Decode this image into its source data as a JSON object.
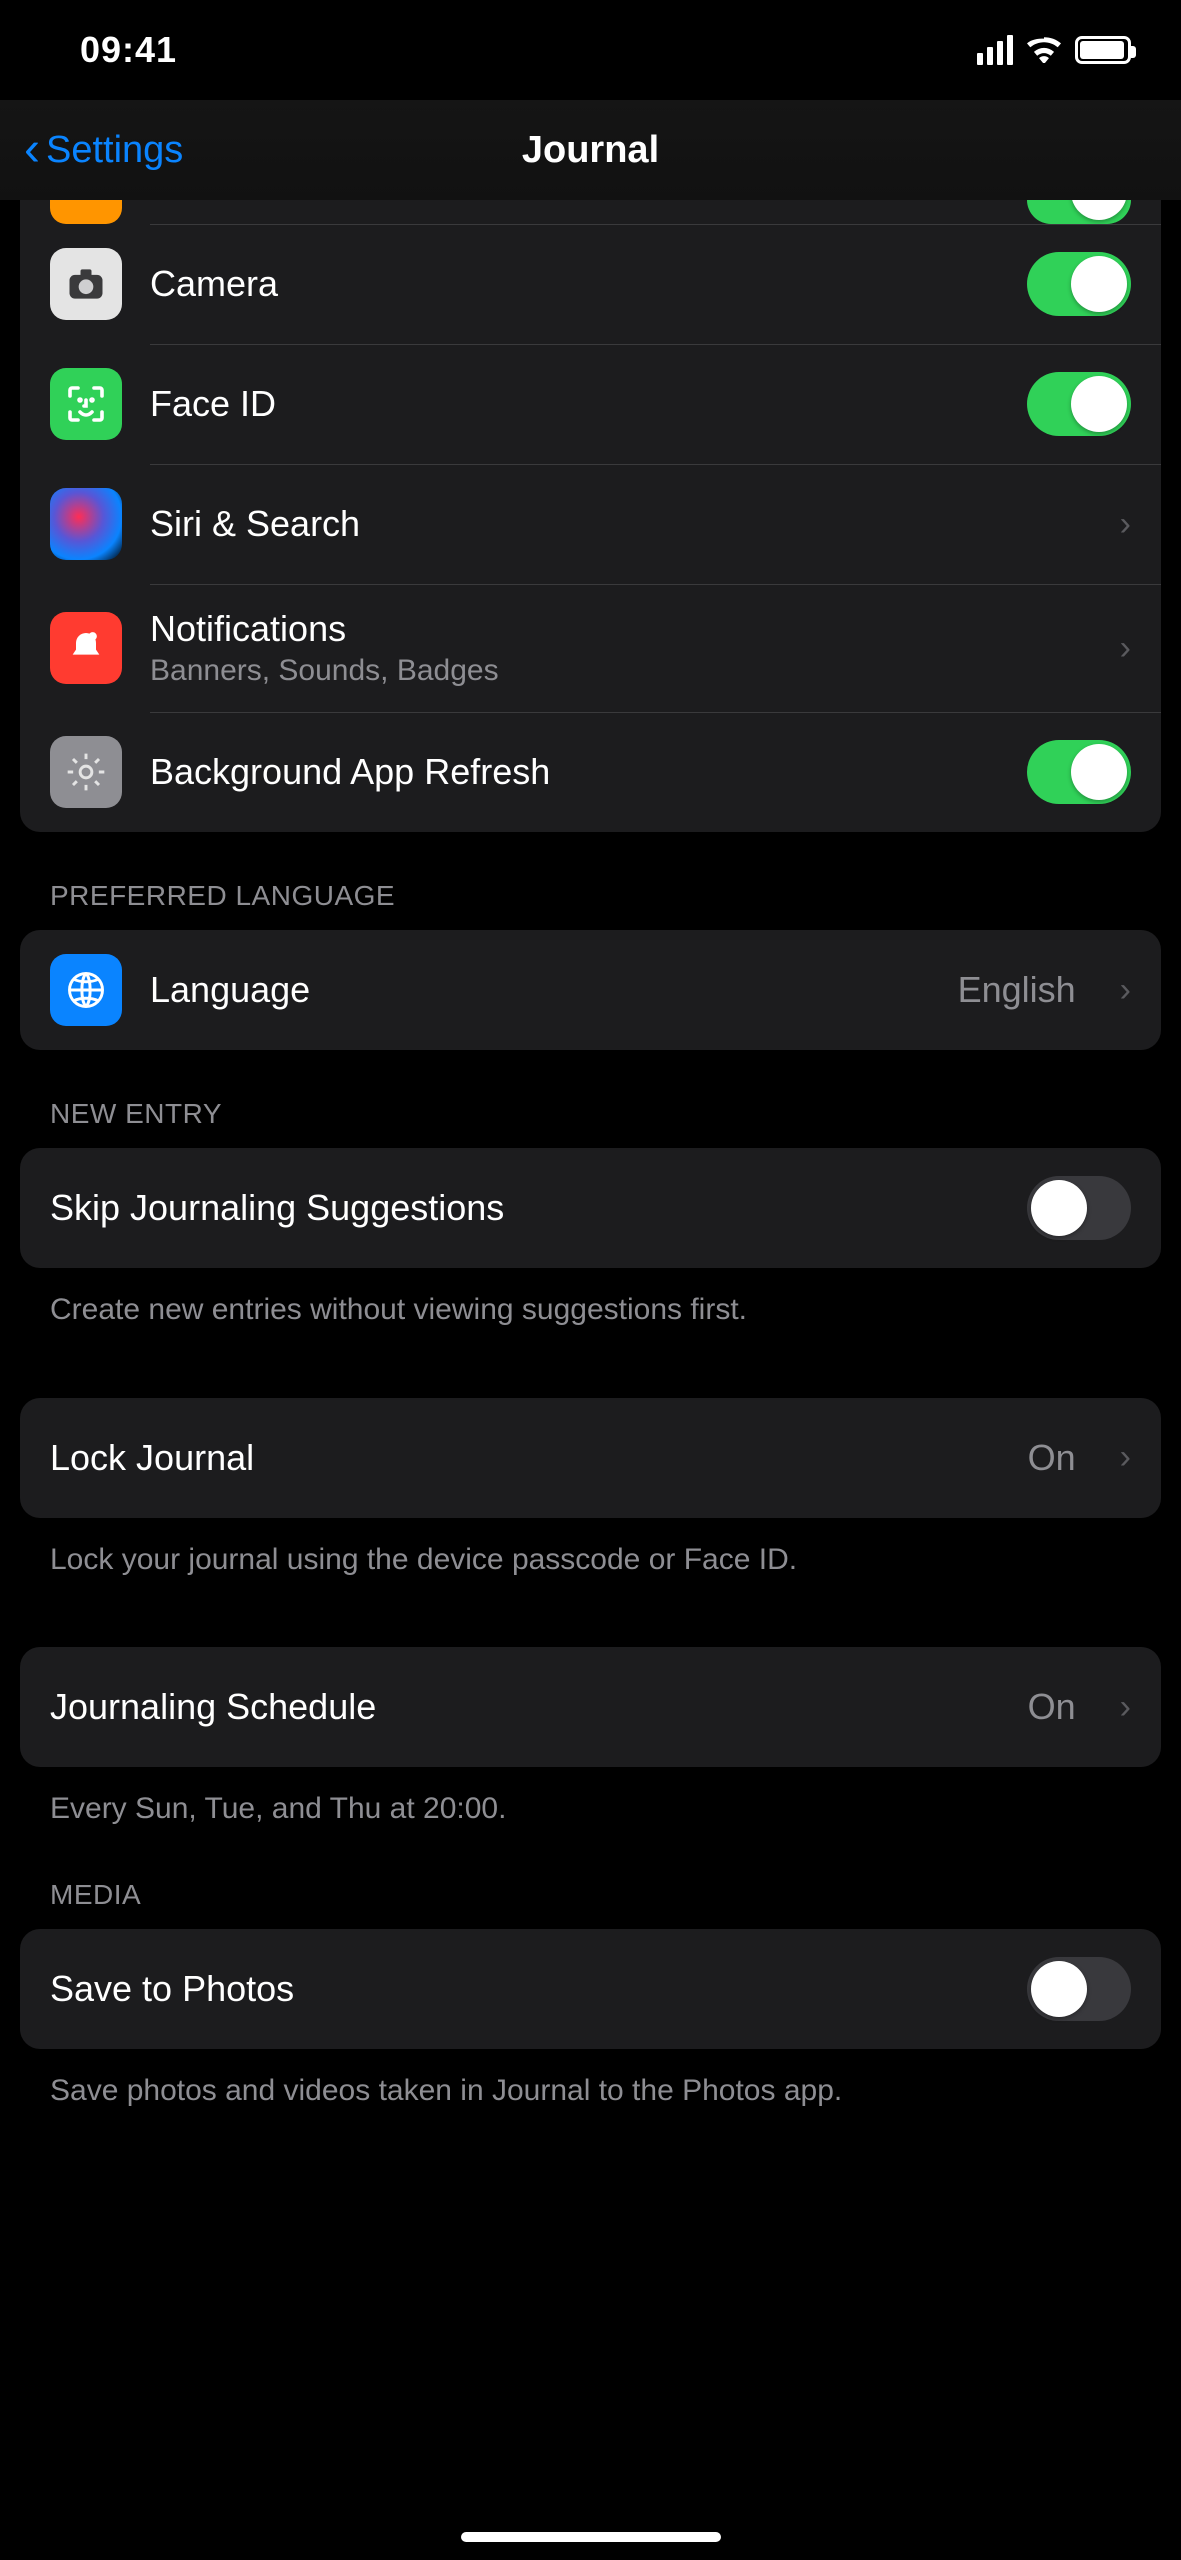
{
  "status": {
    "time": "09:41"
  },
  "nav": {
    "back_label": "Settings",
    "title": "Journal"
  },
  "group1": {
    "rows": [
      {
        "label": "Camera",
        "toggle": true
      },
      {
        "label": "Face ID",
        "toggle": true
      },
      {
        "label": "Siri & Search",
        "nav": true
      },
      {
        "label": "Notifications",
        "sub": "Banners, Sounds, Badges",
        "nav": true
      },
      {
        "label": "Background App Refresh",
        "toggle": true
      }
    ]
  },
  "language": {
    "header": "PREFERRED LANGUAGE",
    "label": "Language",
    "value": "English"
  },
  "new_entry": {
    "header": "NEW ENTRY",
    "skip_label": "Skip Journaling Suggestions",
    "skip_on": false,
    "skip_footer": "Create new entries without viewing suggestions first.",
    "lock_label": "Lock Journal",
    "lock_value": "On",
    "lock_footer": "Lock your journal using the device passcode or Face ID.",
    "schedule_label": "Journaling Schedule",
    "schedule_value": "On",
    "schedule_footer": "Every Sun, Tue, and Thu at 20:00."
  },
  "media": {
    "header": "MEDIA",
    "save_label": "Save to Photos",
    "save_on": false,
    "save_footer": "Save photos and videos taken in Journal to the Photos app."
  }
}
